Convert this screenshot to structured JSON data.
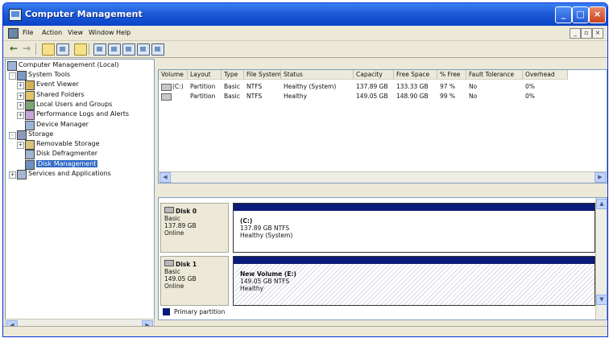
{
  "window": {
    "title": "Computer Management"
  },
  "menu": [
    "File",
    "Action",
    "View",
    "Window",
    "Help"
  ],
  "tree": {
    "root": "Computer Management (Local)",
    "items": [
      {
        "label": "System Tools",
        "level": 1,
        "expander": "-"
      },
      {
        "label": "Event Viewer",
        "level": 2,
        "expander": "+"
      },
      {
        "label": "Shared Folders",
        "level": 2,
        "expander": "+"
      },
      {
        "label": "Local Users and Groups",
        "level": 2,
        "expander": "+"
      },
      {
        "label": "Performance Logs and Alerts",
        "level": 2,
        "expander": "+"
      },
      {
        "label": "Device Manager",
        "level": 2,
        "expander": ""
      },
      {
        "label": "Storage",
        "level": 1,
        "expander": "-"
      },
      {
        "label": "Removable Storage",
        "level": 2,
        "expander": "+"
      },
      {
        "label": "Disk Defragmenter",
        "level": 2,
        "expander": ""
      },
      {
        "label": "Disk Management",
        "level": 2,
        "expander": "",
        "selected": true
      },
      {
        "label": "Services and Applications",
        "level": 1,
        "expander": "+"
      }
    ]
  },
  "volume_table": {
    "columns": [
      "Volume",
      "Layout",
      "Type",
      "File System",
      "Status",
      "Capacity",
      "Free Space",
      "% Free",
      "Fault Tolerance",
      "Overhead"
    ],
    "rows": [
      [
        "(C:)",
        "Partition",
        "Basic",
        "NTFS",
        "Healthy (System)",
        "137.89 GB",
        "133.33 GB",
        "97 %",
        "No",
        "0%"
      ],
      [
        "",
        "Partition",
        "Basic",
        "NTFS",
        "Healthy",
        "149.05 GB",
        "148.90 GB",
        "99 %",
        "No",
        "0%"
      ]
    ]
  },
  "disks": [
    {
      "name": "Disk 0",
      "type": "Basic",
      "size": "137.89 GB",
      "status": "Online",
      "partition": {
        "name": "(C:)",
        "detail": "137.89 GB NTFS",
        "status": "Healthy (System)"
      }
    },
    {
      "name": "Disk 1",
      "type": "Basic",
      "size": "149.05 GB",
      "status": "Online",
      "partition": {
        "name": "New Volume (E:)",
        "detail": "149.05 GB NTFS",
        "status": "Healthy"
      }
    }
  ],
  "legend": {
    "primary_partition": "Primary partition"
  },
  "colors": {
    "titlebar": "#0a43c8",
    "partition_bar": "#0a1a7a",
    "selection": "#316ac5"
  }
}
